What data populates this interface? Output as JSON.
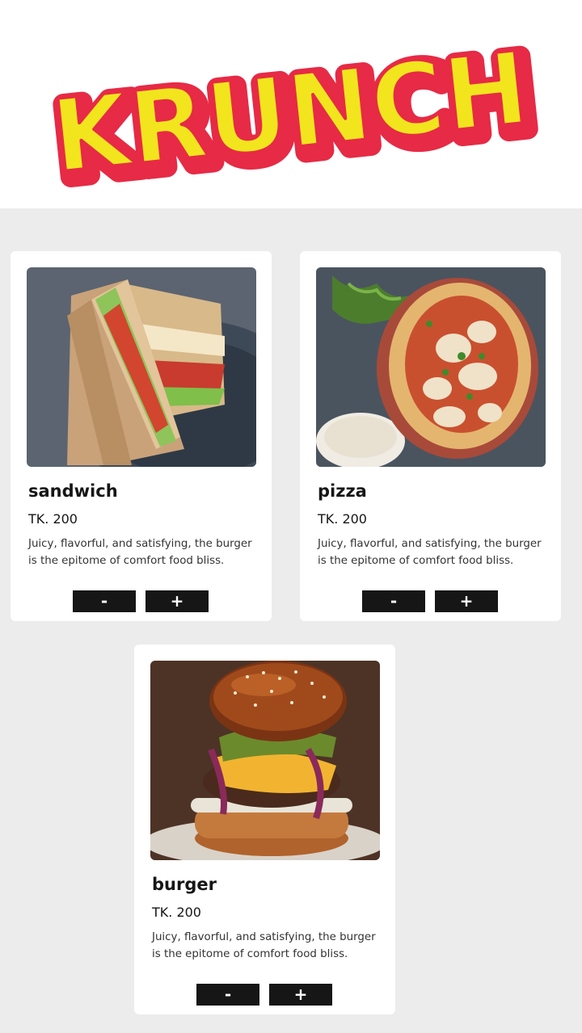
{
  "header": {
    "logo_text": "KRUNCH",
    "colors": {
      "fill": "#f2e51d",
      "outline": "#e72a45"
    }
  },
  "menu": {
    "items": [
      {
        "name": "sandwich",
        "price": "TK. 200",
        "description": "Juicy, flavorful, and satisfying, the burger is the epitome of comfort food bliss.",
        "image": "sandwich-photo",
        "decrement_label": "-",
        "increment_label": "+"
      },
      {
        "name": "pizza",
        "price": "TK. 200",
        "description": "Juicy, flavorful, and satisfying, the burger is the epitome of comfort food bliss.",
        "image": "pizza-photo",
        "decrement_label": "-",
        "increment_label": "+"
      },
      {
        "name": "burger",
        "price": "TK. 200",
        "description": "Juicy, flavorful, and satisfying, the burger is the epitome of comfort food bliss.",
        "image": "burger-photo",
        "decrement_label": "-",
        "increment_label": "+"
      }
    ]
  },
  "colors": {
    "page_bg": "#ececec",
    "card_bg": "#ffffff",
    "button_bg": "#161616"
  }
}
